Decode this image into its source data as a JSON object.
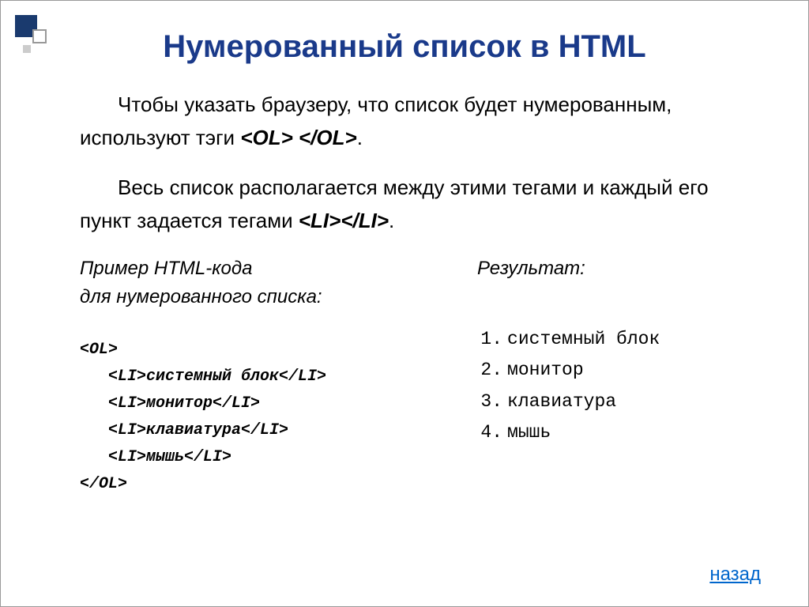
{
  "title": "Нумерованный список в HTML",
  "para1_part1": "Чтобы указать браузеру, что список будет нумерованным, используют тэги ",
  "para1_tag": "<OL> </OL>",
  "para1_part2": ".",
  "para2_part1": "Весь список располагается между этими тегами и каждый его пункт задается тегами ",
  "para2_tag": "<LI></LI>",
  "para2_part2": ".",
  "left_label1": "Пример HTML-кода",
  "left_label2": "для нумерованного списка:",
  "right_label": "Результат:",
  "code": {
    "open": "<OL>",
    "line1": "<LI>системный блок</LI>",
    "line2": "<LI>монитор</LI>",
    "line3": "<LI>клавиатура</LI>",
    "line4": "<LI>мышь</LI>",
    "close": "</OL>"
  },
  "result": {
    "n1": "1.",
    "v1": "системный блок",
    "n2": "2.",
    "v2": "монитор",
    "n3": "3.",
    "v3": "клавиатура",
    "n4": "4.",
    "v4": "мышь"
  },
  "back": "назад"
}
